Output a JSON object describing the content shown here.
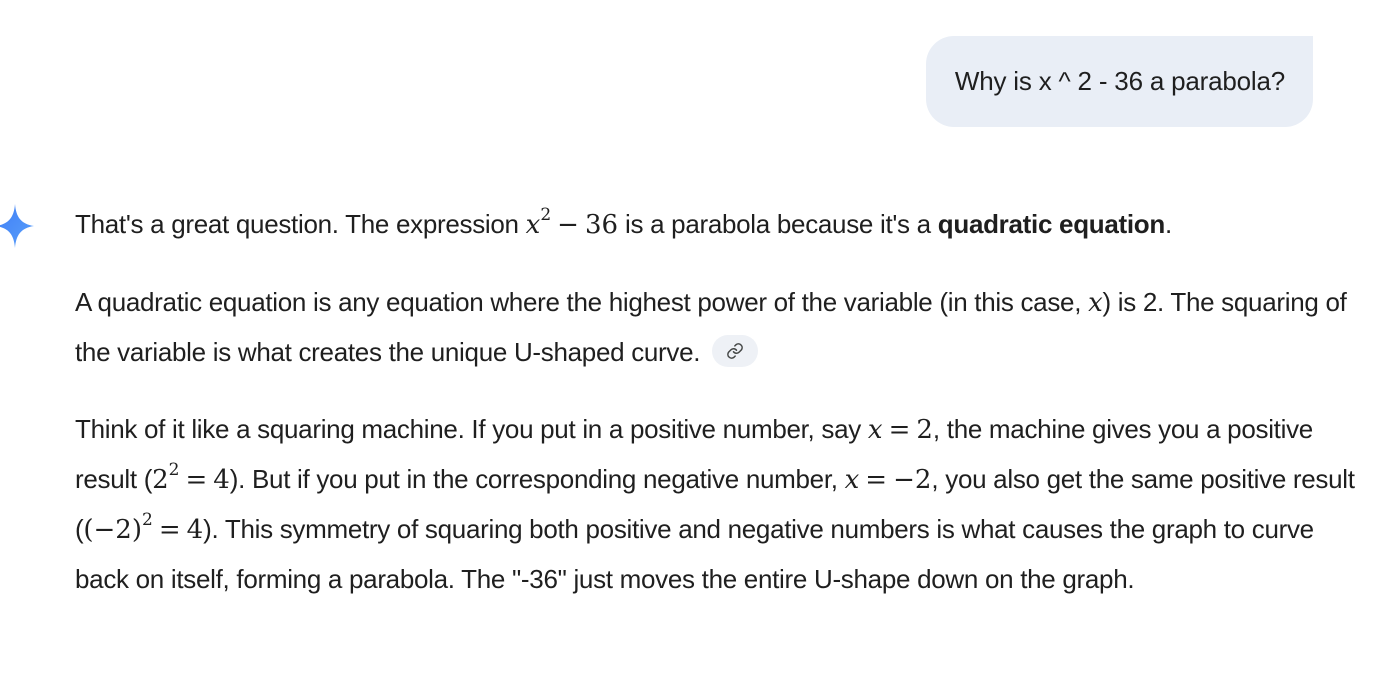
{
  "user_message": {
    "text": "Why is x ^ 2 - 36 a parabola?"
  },
  "response": {
    "p1": {
      "t1": "That's a great question. The expression ",
      "math_base": "x",
      "math_exp": "2",
      "math_op": "−",
      "math_num": "36",
      "t2": " is a parabola because it's a ",
      "bold": "quadratic equation",
      "t3": "."
    },
    "p2": {
      "t1": "A quadratic equation is any equation where the highest power of the variable (in this case, ",
      "var": "x",
      "t2": ") is 2. The squaring of the variable is what creates the unique U-shaped curve."
    },
    "p3": {
      "t1": "Think of it like a squaring machine. If you put in a positive number, say ",
      "m1_var": "x",
      "m1_eq": "=",
      "m1_val": "2",
      "t2": ", the machine gives you a positive result (",
      "m2_base": "2",
      "m2_exp": "2",
      "m2_eq": "=",
      "m2_val": "4",
      "t3": "). But if you put in the corresponding negative number, ",
      "m3_var": "x",
      "m3_eq": "=",
      "m3_val": "−2",
      "t4": ", you also get the same positive result (",
      "m4_base": "(−2)",
      "m4_exp": "2",
      "m4_eq": "=",
      "m4_val": "4",
      "t5": "). This symmetry of squaring both positive and negative numbers is what causes the graph to curve back on itself, forming a parabola. The \"-36\" just moves the entire U-shape down on the graph."
    }
  },
  "icons": {
    "assistant": "gemini-sparkle-icon",
    "source": "link-icon"
  },
  "colors": {
    "bubble_bg": "#e9eef6",
    "sparkle": "#4b8df8",
    "chip_bg": "#eef1f6"
  }
}
